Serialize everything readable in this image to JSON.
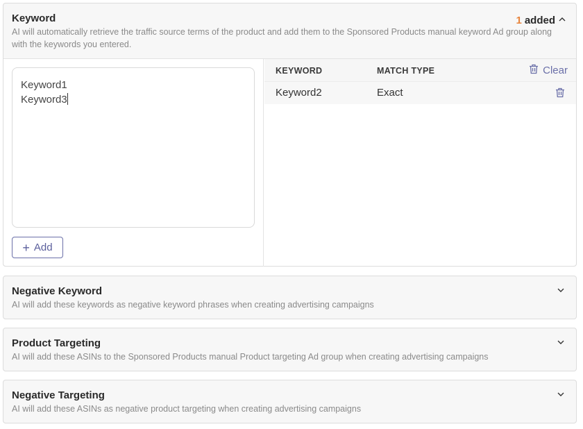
{
  "keyword": {
    "title": "Keyword",
    "description": "AI will automatically retrieve the traffic source terms of the product and add them to the Sponsored Products manual keyword Ad group along with the keywords you entered.",
    "added_count": "1",
    "added_label": "added",
    "textarea_lines": [
      "Keyword1",
      "Keyword3"
    ],
    "add_button": "Add",
    "table": {
      "columns": [
        "KEYWORD",
        "MATCH TYPE"
      ],
      "clear_label": "Clear",
      "rows": [
        {
          "keyword": "Keyword2",
          "match_type": "Exact"
        }
      ]
    }
  },
  "negative_keyword": {
    "title": "Negative Keyword",
    "description": "AI will add these keywords as negative keyword phrases when creating advertising campaigns"
  },
  "product_targeting": {
    "title": "Product Targeting",
    "description": "AI will add these ASINs to the Sponsored Products manual Product targeting Ad group when creating advertising campaigns"
  },
  "negative_targeting": {
    "title": "Negative Targeting",
    "description": "AI will add these ASINs as negative product targeting when creating advertising campaigns"
  },
  "colors": {
    "accent": "#6a6fa8",
    "count": "#e8843c"
  },
  "icons": {
    "collapse": "chevron-up-icon",
    "expand": "chevron-down-icon",
    "delete": "trash-icon",
    "add": "plus-icon"
  }
}
